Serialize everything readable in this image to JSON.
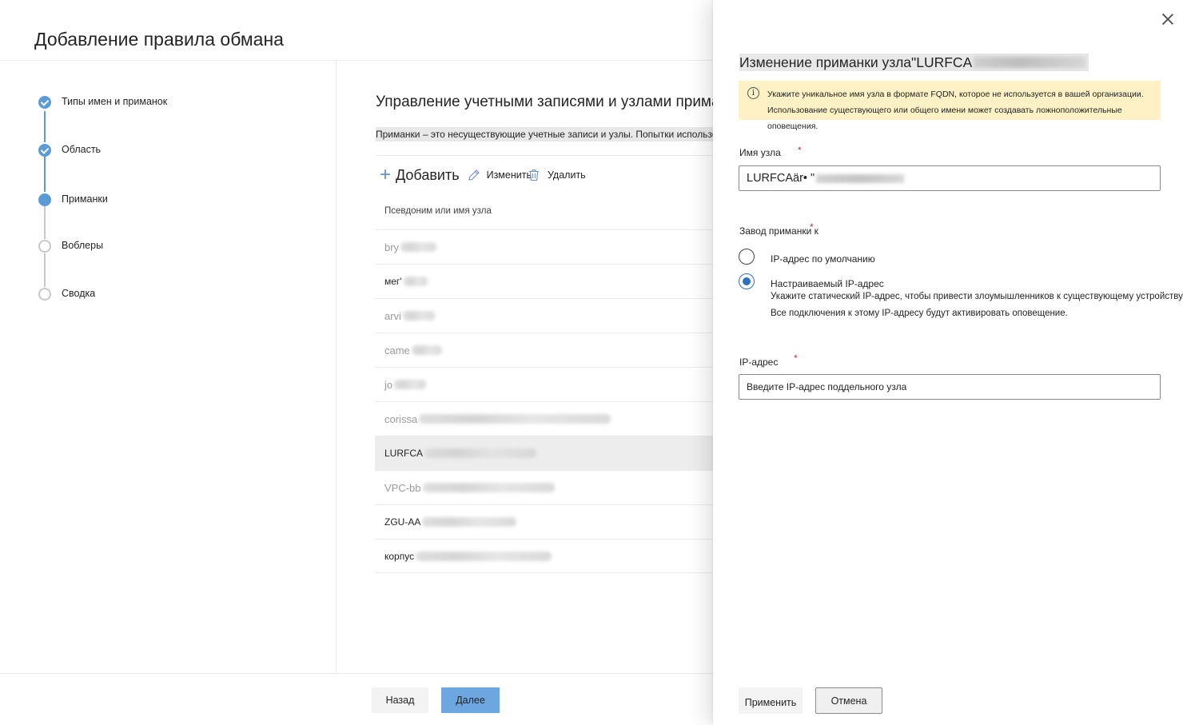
{
  "wizard": {
    "title": "Добавление правила обмана",
    "steps": [
      {
        "label": "Типы имен и приманок",
        "state": "done"
      },
      {
        "label": "Область",
        "state": "done"
      },
      {
        "label": "Приманки",
        "state": "current"
      },
      {
        "label": "Воблеры",
        "state": "todo"
      },
      {
        "label": "Сводка",
        "state": "todo"
      }
    ],
    "section_title": "Управление учетными записями и узлами приманок",
    "section_desc": "Приманки – это несуществующие учетные записи и узлы. Попытки использовать приманку l",
    "toolbar": {
      "add": "Добавить",
      "edit": "Изменить",
      "delete": "Удалить"
    },
    "list_header": "Псевдоним или имя узла",
    "rows": [
      {
        "name": "bry"
      },
      {
        "name": "мег'"
      },
      {
        "name": "arvi"
      },
      {
        "name": "came"
      },
      {
        "name": "jo"
      },
      {
        "name": "corissa"
      },
      {
        "name": "LURFCA"
      },
      {
        "name": "VPC-bb"
      },
      {
        "name": "ZGU-AA"
      },
      {
        "name": "корпус"
      }
    ],
    "back": "Назад",
    "next": "Далее"
  },
  "panel": {
    "title": "Изменение приманки узла\"LURFCA",
    "warning": "Укажите уникальное имя узла в формате FQDN, которое не используется в вашей организации. Использование существующего или общего имени может создавать ложноположительные оповещения.",
    "host_label": "Имя узла",
    "host_value": "LURFCAär• \"",
    "lure_label": "Завод приманки к",
    "radio_default": "IP-адрес по умолчанию",
    "radio_custom": "Настраиваемый IP-адрес",
    "radio_custom_desc1": "Укажите статический IP-адрес, чтобы привести злоумышленников к существующему устройству.",
    "radio_custom_desc2": "Все подключения к этому IP-адресу будут активировать оповещение.",
    "ip_label": "IP-адрес",
    "ip_placeholder": "Введите IP-адрес поддельного узла",
    "apply": "Применить",
    "cancel": "Отмена",
    "required_mark": "*"
  },
  "colors": {
    "accent": "#5b9bd5",
    "primary_button": "#6ea7e0",
    "warning_bg": "#fdf1c5",
    "required": "#c4314b"
  }
}
